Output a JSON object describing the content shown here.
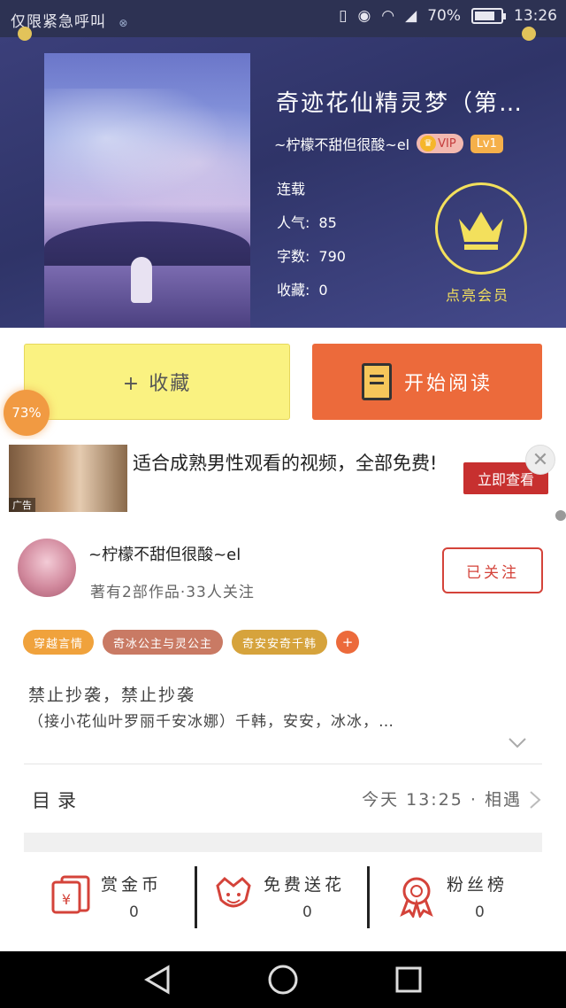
{
  "status_bar": {
    "carrier": "仅限紧急呼叫",
    "battery": "70%",
    "time": "13:26"
  },
  "book": {
    "title": "奇迹花仙精灵梦（第…",
    "author": "~柠檬不甜但很酸~el",
    "vip_label": "VIP",
    "level_label": "Lv1",
    "status": "连载",
    "popularity_label": "人气:",
    "popularity": "85",
    "words_label": "字数:",
    "words": "790",
    "favorites_label": "收藏:",
    "favorites": "0",
    "member_label": "点亮会员"
  },
  "actions": {
    "favorite": "+ 收藏",
    "read": "开始阅读",
    "progress": "73%"
  },
  "ad": {
    "text": "适合成熟男性观看的视频，全部免费!",
    "tag": "广告",
    "cta": "立即查看"
  },
  "author_card": {
    "name": "~柠檬不甜但很酸~el",
    "subtitle": "著有2部作品·33人关注",
    "follow": "已关注"
  },
  "tags": [
    "穿越言情",
    "奇冰公主与灵公主",
    "奇安安奇千韩"
  ],
  "description": {
    "line1": "禁止抄袭，禁止抄袭",
    "line2": "（接小花仙叶罗丽千安冰娜）千韩，安安，冰冰，…"
  },
  "catalog": {
    "label": "目录",
    "update": "今天 13:25 · 相遇"
  },
  "stats": [
    {
      "label": "赏金币",
      "value": "0",
      "icon": "red-envelope-icon"
    },
    {
      "label": "免费送花",
      "value": "0",
      "icon": "flower-icon"
    },
    {
      "label": "粉丝榜",
      "value": "0",
      "icon": "rosette-icon"
    }
  ],
  "colors": {
    "header": "#3b3f7a",
    "accent_orange": "#ec6a3b",
    "favorite_yellow": "#faf281",
    "member_gold": "#f3e05c"
  }
}
